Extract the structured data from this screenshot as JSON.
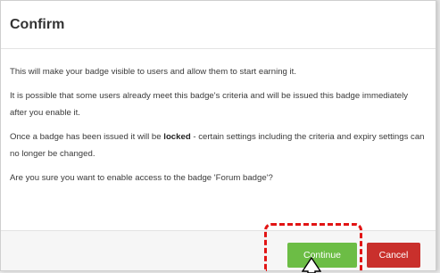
{
  "dialog": {
    "title": "Confirm",
    "paragraphs": [
      "This will make your badge visible to users and allow them to start earning it.",
      "It is possible that some users already meet this badge's criteria and will be issued this badge immediately after you enable it.",
      "Once a badge has been issued it will be",
      "locked",
      "- certain settings including the criteria and expiry settings can no longer be changed.",
      "Are you sure you want to enable access to the badge 'Forum badge'?"
    ],
    "continue_label": "Continue",
    "cancel_label": "Cancel"
  },
  "colors": {
    "continue": "#6cbd45",
    "cancel": "#c9302c",
    "highlight": "#e21414"
  },
  "icons": {
    "pointer": "arrow-pointer-icon"
  }
}
